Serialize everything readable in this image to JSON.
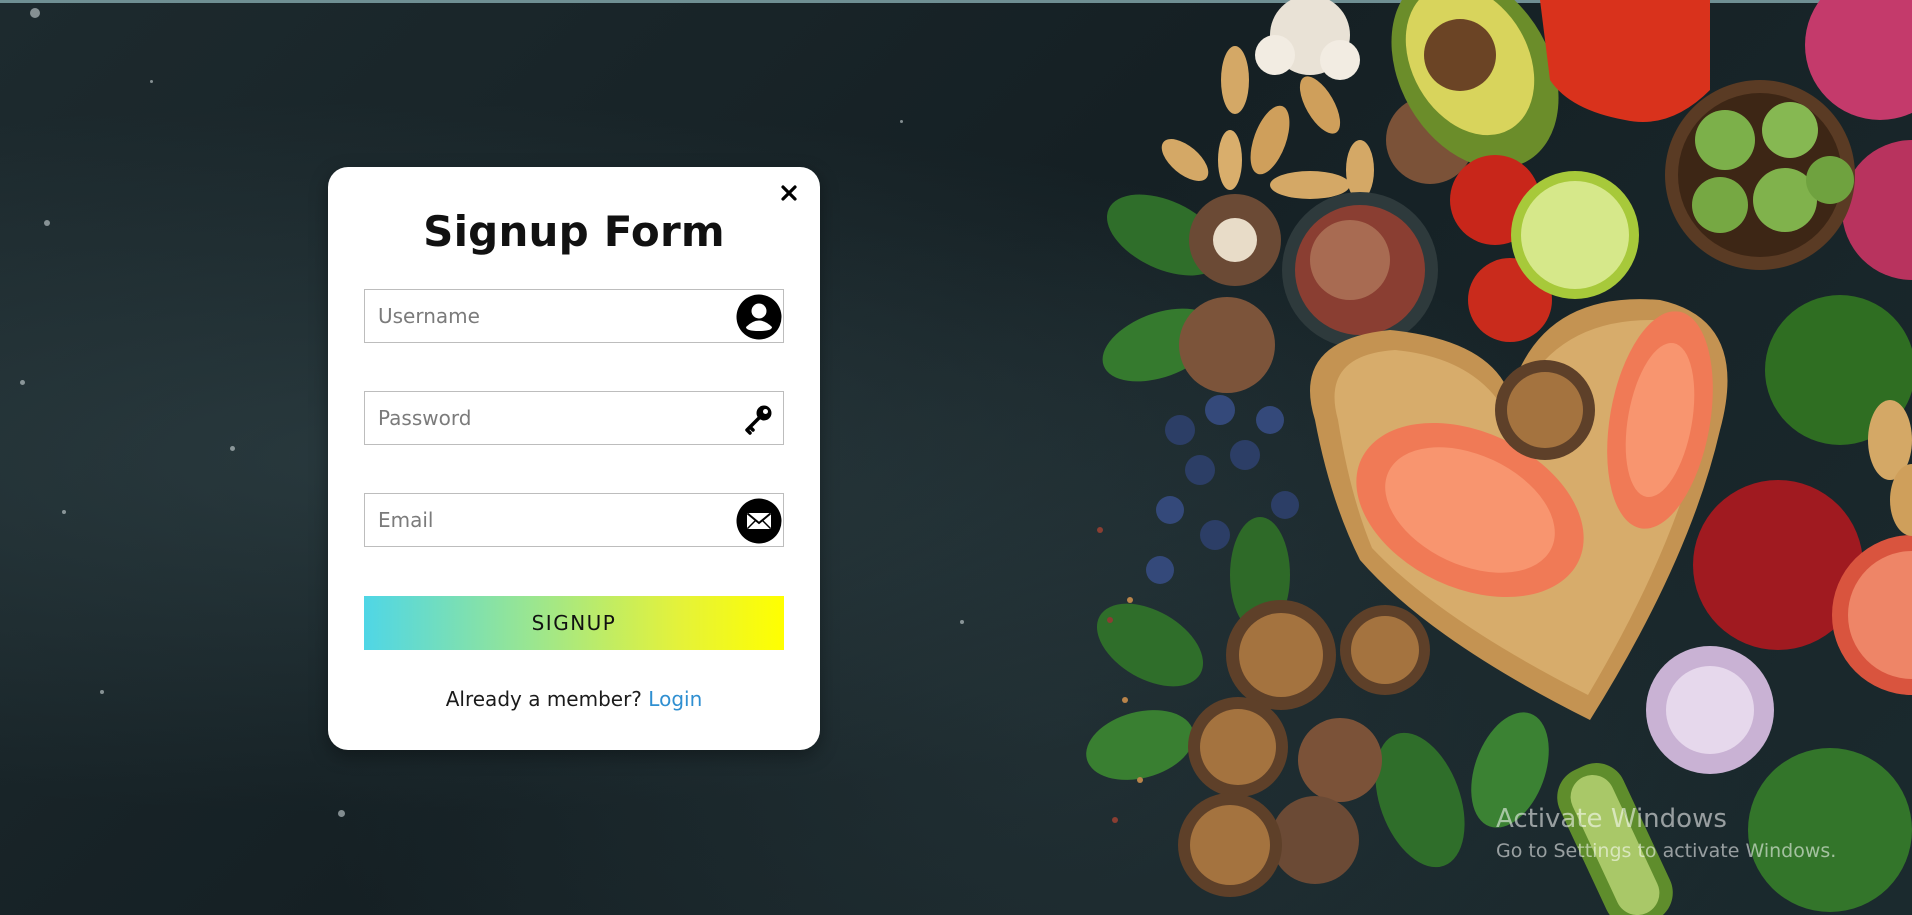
{
  "form": {
    "title": "Signup Form",
    "username_placeholder": "Username",
    "password_placeholder": "Password",
    "email_placeholder": "Email",
    "submit_label": "SIGNUP",
    "member_text": "Already a member?",
    "login_link": "Login"
  },
  "icons": {
    "close": "close-icon",
    "username": "user-icon",
    "password": "key-icon",
    "email": "envelope-icon"
  },
  "watermark": {
    "line1": "Activate Windows",
    "line2": "Go to Settings to activate Windows."
  },
  "colors": {
    "card_bg": "#ffffff",
    "button_gradient_start": "#4fd6e6",
    "button_gradient_end": "#ffff00",
    "link": "#2f8fd1",
    "background": "#1a2326"
  }
}
